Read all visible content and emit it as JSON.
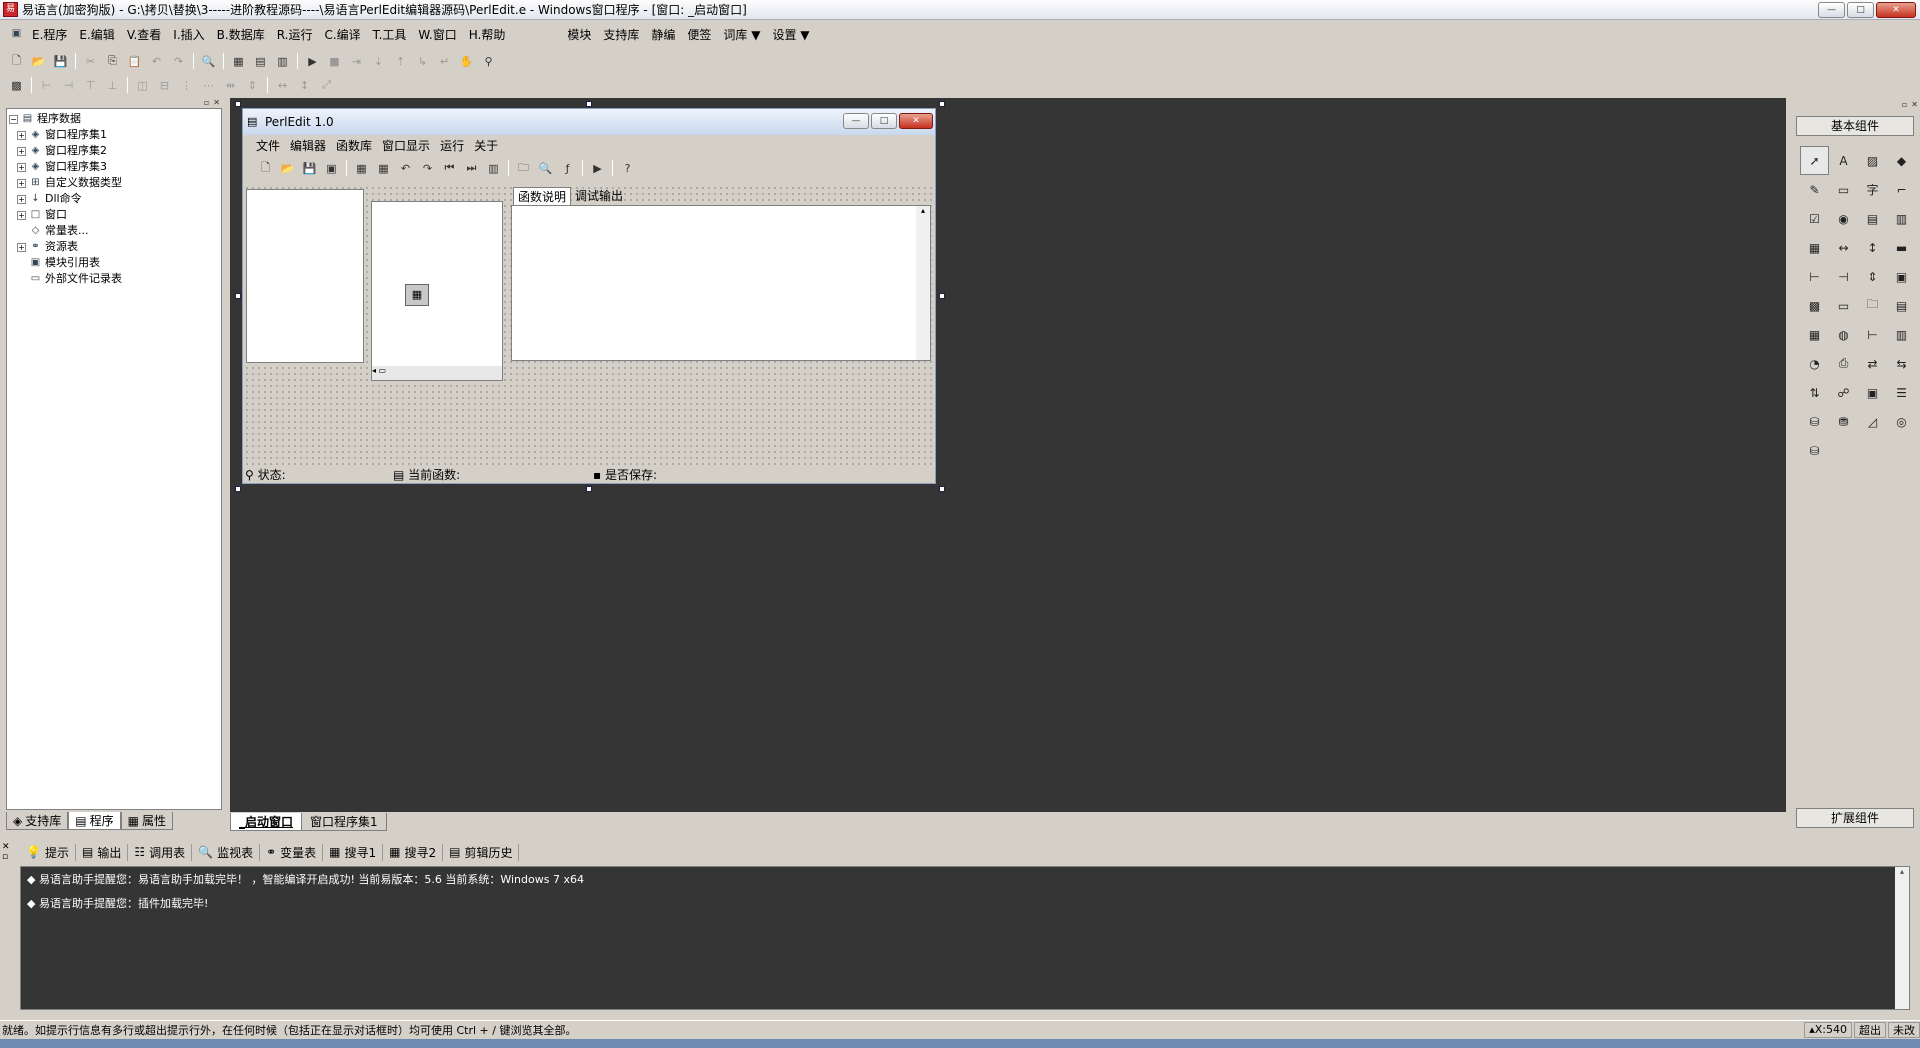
{
  "window": {
    "title": "易语言(加密狗版) - G:\\拷贝\\替换\\3-----进阶教程源码----\\易语言PerlEdit编辑器源码\\PerlEdit.e - Windows窗口程序 - [窗口: _启动窗口]",
    "min": "—",
    "max": "□",
    "close": "✕"
  },
  "menu": {
    "items": [
      "E.程序",
      "E.编辑",
      "V.查看",
      "I.插入",
      "B.数据库",
      "R.运行",
      "C.编译",
      "T.工具",
      "W.窗口",
      "H.帮助"
    ],
    "extra": [
      "模块",
      "支持库",
      "静编",
      "便签",
      "词库 ▼",
      "设置 ▼"
    ]
  },
  "tree": {
    "root": "程序数据",
    "items": [
      "窗口程序集1",
      "窗口程序集2",
      "窗口程序集3",
      "自定义数据类型",
      "Dll命令",
      "窗口",
      "常量表...",
      "资源表",
      "模块引用表",
      "外部文件记录表"
    ]
  },
  "left_tabs": [
    "支持库",
    "程序",
    "属性"
  ],
  "perledit": {
    "title": "PerlEdit 1.0",
    "menu": [
      "文件",
      "编辑器",
      "函数库",
      "窗口显示",
      "运行",
      "关于"
    ],
    "tabs": [
      "函数说明",
      "调试输出"
    ],
    "status": [
      "状态:",
      "当前函数:",
      "是否保存:"
    ]
  },
  "doc_tabs": [
    "_启动窗口",
    "窗口程序集1"
  ],
  "components": {
    "header": "基本组件",
    "footer": "扩展组件"
  },
  "output_tabs": [
    "提示",
    "输出",
    "调用表",
    "监视表",
    "变量表",
    "搜寻1",
    "搜寻2",
    "剪辑历史"
  ],
  "output_lines": [
    "◆ 易语言助手提醒您：易语言助手加载完毕！ ，智能编译开启成功!  当前易版本：5.6  当前系统：Windows 7 x64",
    "◆ 易语言助手提醒您：插件加载完毕!"
  ],
  "status": {
    "text": "就绪。如提示行信息有多行或超出提示行外，在任何时候（包括正在显示对话框时）均可使用 Ctrl + / 键浏览其全部。",
    "coord": "X:540",
    "mode1": "超出",
    "mode2": "未改"
  }
}
